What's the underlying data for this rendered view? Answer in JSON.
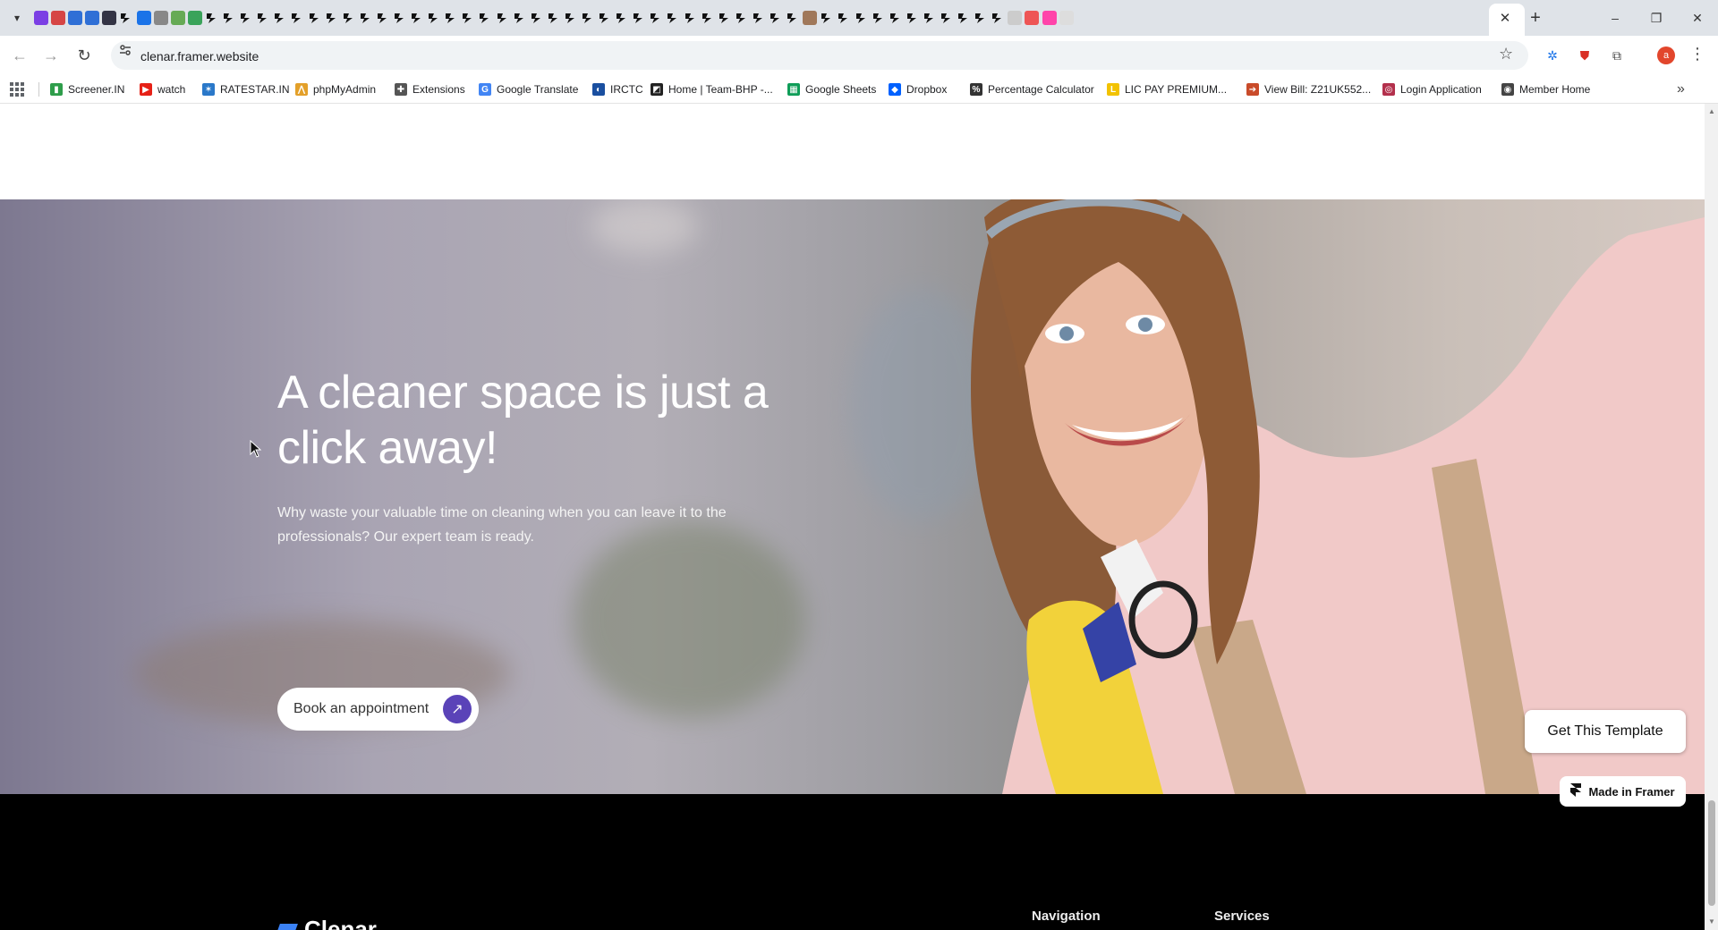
{
  "browser": {
    "url": "clenar.framer.website",
    "tab_close_glyph": "✕",
    "new_tab_glyph": "+",
    "profile_initial": "a",
    "window": {
      "minimize": "–",
      "restore": "❐",
      "close": "✕"
    },
    "pinned_tab_favicons": [
      "#7b3fe4",
      "#d64545",
      "#2f6fd6",
      "#2f6fd6",
      "#334",
      "mono",
      "#1b73e8",
      "#888",
      "#6a5",
      "#3aa35a",
      "mono",
      "mono",
      "mono",
      "mono",
      "mono",
      "mono",
      "mono",
      "mono",
      "mono",
      "mono",
      "mono",
      "mono",
      "mono",
      "mono",
      "mono",
      "mono",
      "mono",
      "mono",
      "mono",
      "mono",
      "mono",
      "mono",
      "mono",
      "mono",
      "mono",
      "mono",
      "mono",
      "mono",
      "mono",
      "mono",
      "mono",
      "mono",
      "mono",
      "mono",
      "mono",
      "#a0785a",
      "mono",
      "mono",
      "mono",
      "mono",
      "mono",
      "mono",
      "mono",
      "mono",
      "mono",
      "mono",
      "mono",
      "#ccc",
      "#e55",
      "#f4a",
      "#ddd"
    ]
  },
  "bookmarks": [
    {
      "label": "Screener.IN",
      "color": "#2e9d4a",
      "glyph": "▮"
    },
    {
      "label": "watch",
      "color": "#e62117",
      "glyph": "▶"
    },
    {
      "label": "RATESTAR.IN",
      "color": "#2a78c9",
      "glyph": "✶"
    },
    {
      "label": "phpMyAdmin",
      "color": "#e3a02a",
      "glyph": "⋀"
    },
    {
      "label": "Extensions",
      "color": "#555",
      "glyph": "✚"
    },
    {
      "label": "Google Translate",
      "color": "#4285f4",
      "glyph": "G"
    },
    {
      "label": "IRCTC",
      "color": "#1a4fa0",
      "glyph": "◐"
    },
    {
      "label": "Home | Team-BHP -...",
      "color": "#222",
      "glyph": "◩"
    },
    {
      "label": "Google Sheets",
      "color": "#0f9d58",
      "glyph": "▦"
    },
    {
      "label": "Dropbox",
      "color": "#0061fe",
      "glyph": "◆"
    },
    {
      "label": "Percentage Calculator",
      "color": "#333",
      "glyph": "%"
    },
    {
      "label": "LIC PAY PREMIUM...",
      "color": "#f2c200",
      "glyph": "L"
    },
    {
      "label": "View Bill: Z21UK552...",
      "color": "#c94b2a",
      "glyph": "➔"
    },
    {
      "label": "Login Application",
      "color": "#b3304c",
      "glyph": "◎"
    },
    {
      "label": "Member Home",
      "color": "#444",
      "glyph": "◉"
    }
  ],
  "hero": {
    "title": "A cleaner space is just a click away!",
    "subtitle": "Why waste your valuable time on cleaning when you can leave it to the professionals? Our expert team is ready.",
    "cta_label": "Book an appointment",
    "cta_arrow": "↗"
  },
  "footer": {
    "brand": "Clenar",
    "columns": [
      "Navigation",
      "Services"
    ]
  },
  "overlay": {
    "get_template": "Get This Template",
    "made_in_framer": "Made in Framer"
  },
  "colors": {
    "accent": "#5a43b8",
    "footer_bg": "#000000"
  }
}
